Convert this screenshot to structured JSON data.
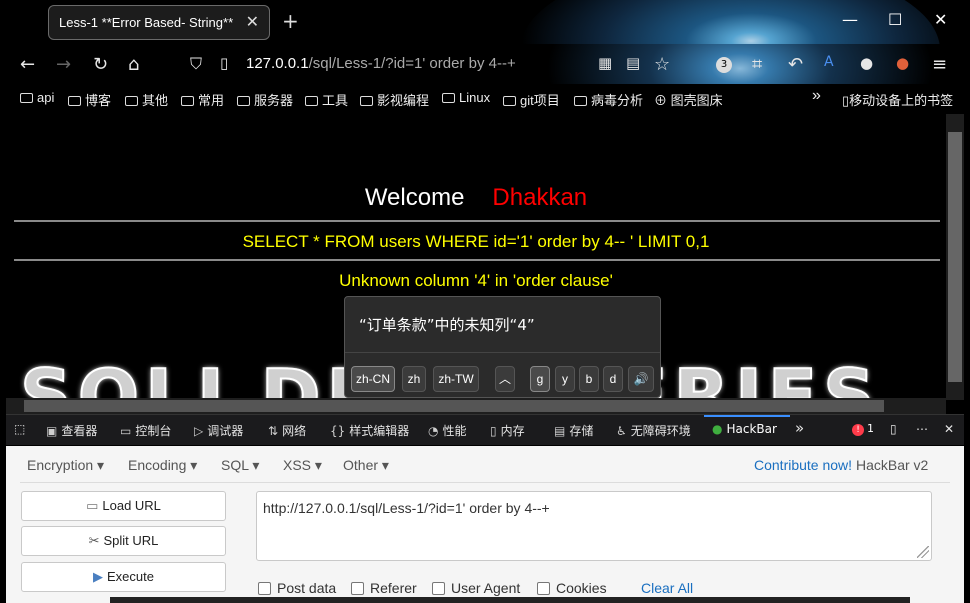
{
  "browser": {
    "tab_title": "Less-1 **Error Based- String**",
    "tab_close": "✕",
    "new_tab": "+",
    "window_controls": {
      "minimize": "—",
      "maximize": "☐",
      "close": "✕"
    },
    "url_host": "127.0.0.1",
    "url_path": "/sql/Less-1/?id=1' order by 4--+",
    "extension_badge": "3",
    "bookmarks": [
      "api",
      "博客",
      "其他",
      "常用",
      "服务器",
      "工具",
      "影视编程",
      "Linux",
      "git项目",
      "病毒分析",
      "图壳图床"
    ],
    "bookmarks_overflow": "»",
    "mobile_bookmarks": "移动设备上的书签"
  },
  "page": {
    "welcome": "Welcome",
    "name": "Dhakkan",
    "sql_query": "SELECT * FROM users WHERE id='1' order by 4-- ' LIMIT 0,1",
    "error_message": "Unknown column '4' in 'order clause'",
    "banner": "SQLI DUMB SERIES"
  },
  "translate_popup": {
    "translation": "“订单条款”中的未知列“4”",
    "langs": [
      "zh-CN",
      "zh",
      "zh-TW"
    ],
    "up": "︿",
    "engines": [
      "g",
      "y",
      "b",
      "d"
    ],
    "speak": "🔊"
  },
  "devtools": {
    "tabs": [
      "查看器",
      "控制台",
      "调试器",
      "网络",
      "样式编辑器",
      "性能",
      "内存",
      "存储",
      "无障碍环境",
      "HackBar"
    ],
    "overflow": "»",
    "error_count": "1",
    "more": "⋯",
    "close": "✕"
  },
  "hackbar": {
    "menus": [
      "Encryption",
      "Encoding",
      "SQL",
      "XSS",
      "Other"
    ],
    "contribute": "Contribute now!",
    "version": "HackBar v2",
    "load_url": "Load URL",
    "split_url": "Split URL",
    "execute": "Execute",
    "url_value": "http://127.0.0.1/sql/Less-1/?id=1' order by 4--+",
    "options": [
      "Post data",
      "Referer",
      "User Agent",
      "Cookies"
    ],
    "clear_all": "Clear All"
  },
  "colors": {
    "welcome_name": "#ff0000",
    "sql_text": "#ffff00",
    "link": "#1a6fc0"
  }
}
